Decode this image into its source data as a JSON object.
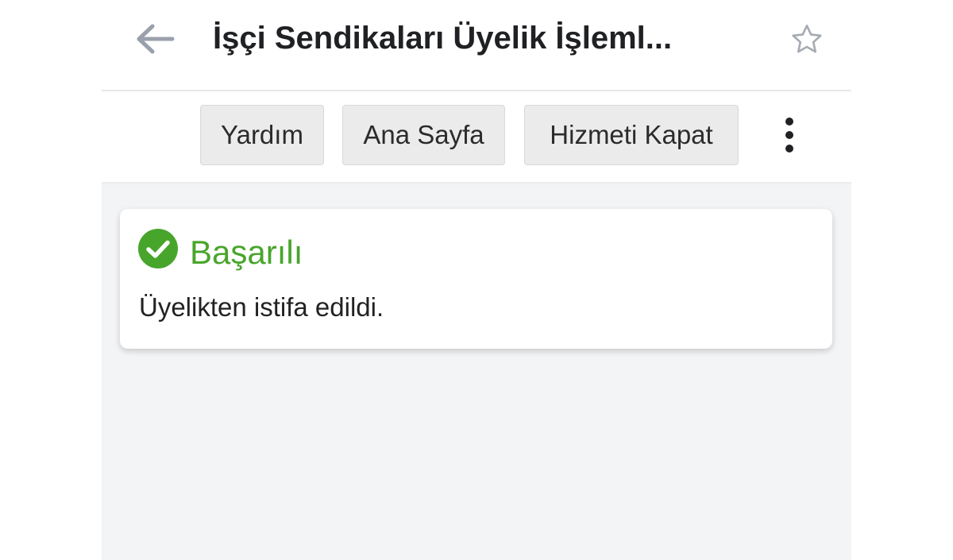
{
  "header": {
    "title": "İşçi Sendikaları Üyelik İşleml...",
    "back_icon": "arrow-left-icon",
    "favorite_icon": "star-outline-icon"
  },
  "toolbar": {
    "help_label": "Yardım",
    "home_label": "Ana Sayfa",
    "close_service_label": "Hizmeti Kapat",
    "more_icon": "more-vertical-icon"
  },
  "alert": {
    "icon": "check-circle-icon",
    "title": "Başarılı",
    "message": "Üyelikten istifa edildi."
  },
  "colors": {
    "success": "#48a52c",
    "content_background": "#f3f4f6",
    "button_background": "#ebebeb"
  }
}
